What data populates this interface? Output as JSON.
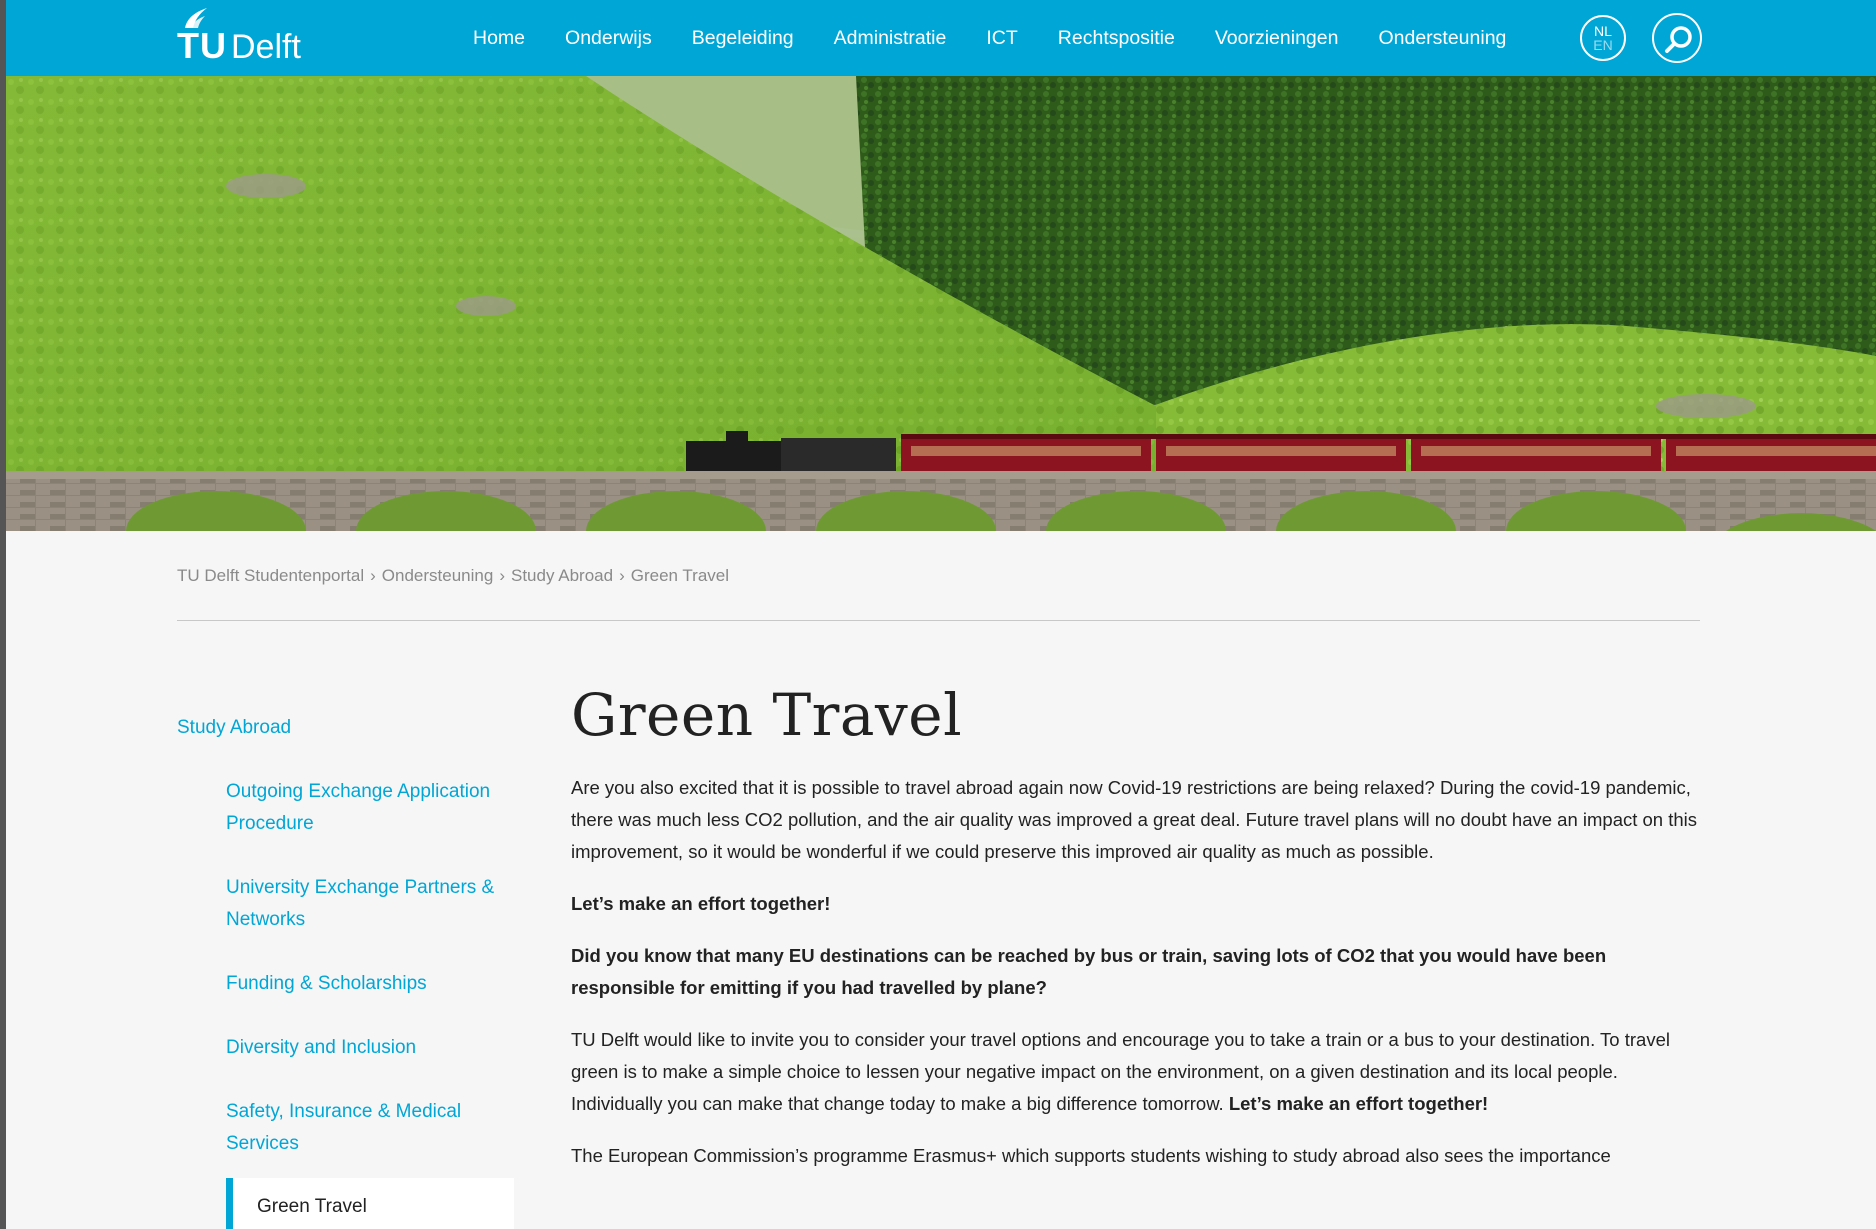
{
  "header": {
    "logo_tu": "TU",
    "logo_delft": "Delft",
    "nav": [
      "Home",
      "Onderwijs",
      "Begeleiding",
      "Administratie",
      "ICT",
      "Rechtspositie",
      "Voorzieningen",
      "Ondersteuning"
    ],
    "lang_nl": "NL",
    "lang_en": "EN",
    "accent": "#00a6d6"
  },
  "breadcrumb": [
    "TU Delft Studentenportal",
    "Ondersteuning",
    "Study Abroad",
    "Green Travel"
  ],
  "breadcrumb_sep": "›",
  "sidebar": {
    "parent": "Study Abroad",
    "items": [
      "Outgoing Exchange Application Procedure",
      "University Exchange Partners & Networks",
      "Funding & Scholarships",
      "Diversity and Inclusion",
      "Safety, Insurance & Medical Services"
    ],
    "active": "Green Travel"
  },
  "main": {
    "title": "Green Travel",
    "p1": "Are you also excited that it is possible to travel abroad again now Covid-19 restrictions are being relaxed? During the covid-19 pandemic, there was much less CO2 pollution, and the air quality was improved a great deal. Future travel plans will no doubt have an impact on this improvement, so it would be wonderful if we could preserve this improved air quality as much as possible.",
    "p2": "Let’s make an effort together!",
    "p3": "Did you know that many EU destinations can be reached by bus or train, saving lots of CO2 that you would have been responsible for emitting if you had travelled by plane?",
    "p4_text": "TU Delft would like to invite you to consider your travel options and encourage you to take a train or a bus to your destination. To travel green is to make a simple choice to lessen your negative impact on the environment, on a given destination and its local people. Individually you can make that change today to make a big difference tomorrow. ",
    "p4_bold": "Let’s make an effort together!",
    "p5": "The European Commission’s programme Erasmus+ which supports students wishing to study abroad also sees the importance"
  }
}
